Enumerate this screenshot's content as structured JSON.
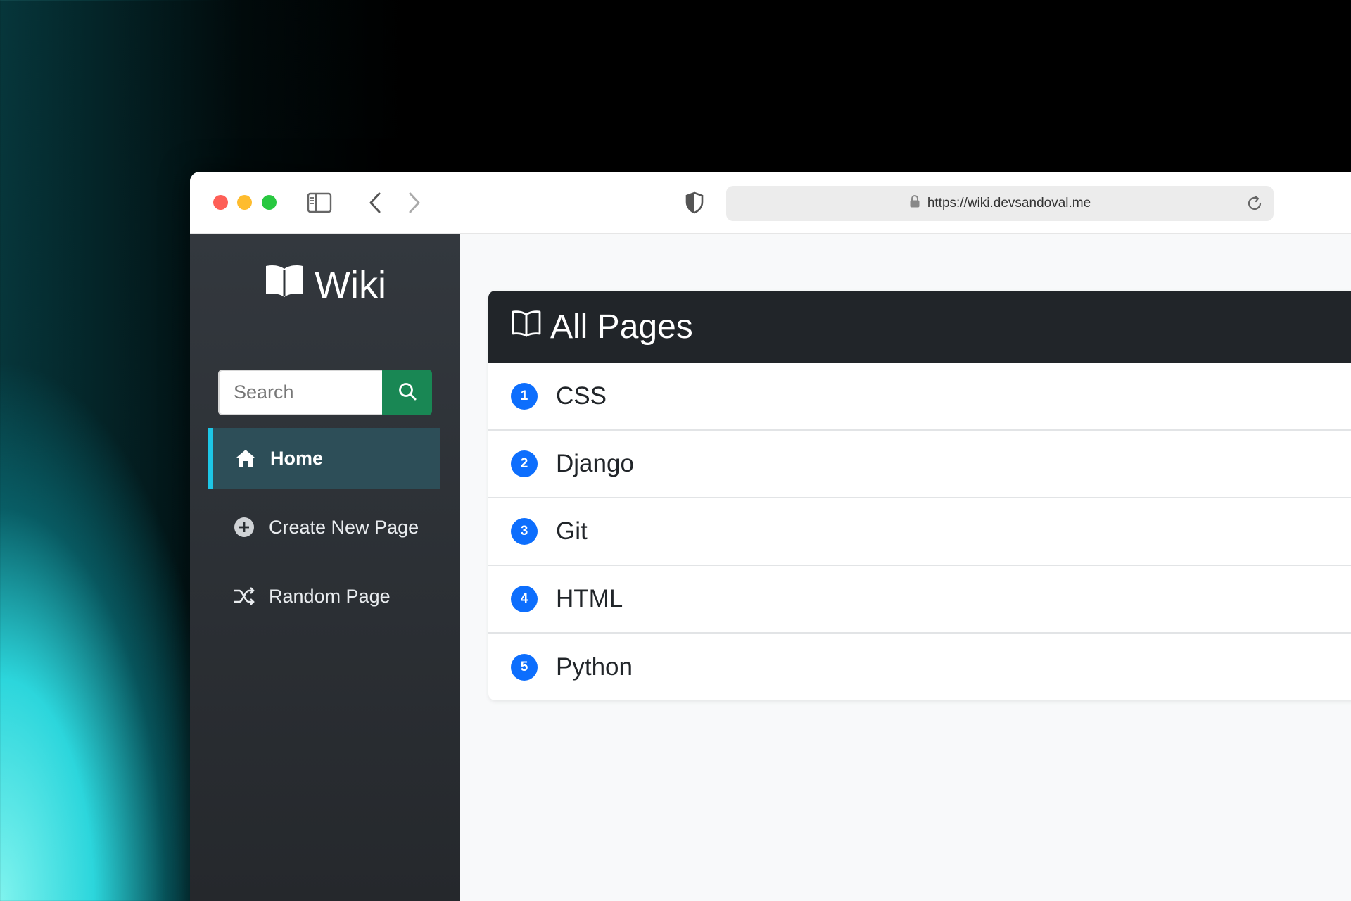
{
  "browser": {
    "url": "https://wiki.devsandoval.me"
  },
  "sidebar": {
    "brand": "Wiki",
    "search_placeholder": "Search",
    "nav": [
      {
        "label": "Home",
        "icon": "home-icon",
        "active": true
      },
      {
        "label": "Create New Page",
        "icon": "plus-circle-icon",
        "active": false
      },
      {
        "label": "Random Page",
        "icon": "shuffle-icon",
        "active": false
      }
    ]
  },
  "main": {
    "title": "All Pages",
    "pages": [
      {
        "number": "1",
        "title": "CSS"
      },
      {
        "number": "2",
        "title": "Django"
      },
      {
        "number": "3",
        "title": "Git"
      },
      {
        "number": "4",
        "title": "HTML"
      },
      {
        "number": "5",
        "title": "Python"
      }
    ]
  },
  "colors": {
    "sidebar_bg": "#2b2f33",
    "active_nav_bg": "#2d4e58",
    "active_nav_accent": "#1dc6e6",
    "search_button": "#198754",
    "card_header": "#212529",
    "badge": "#0d6efd"
  }
}
